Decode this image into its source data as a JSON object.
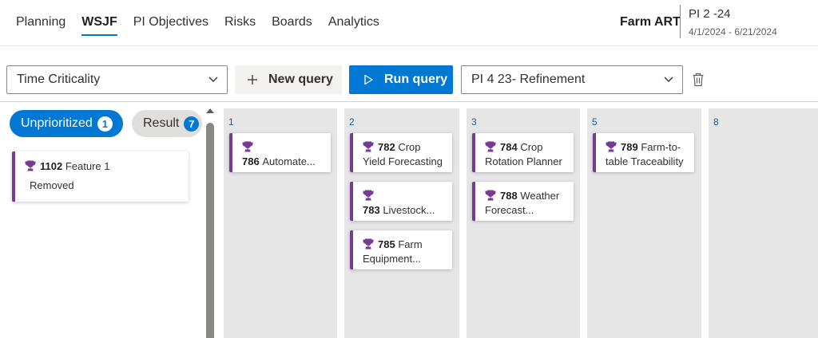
{
  "nav": {
    "tabs": [
      "Planning",
      "WSJF",
      "PI Objectives",
      "Risks",
      "Boards",
      "Analytics"
    ],
    "active_tab": "WSJF",
    "team": "Farm ART",
    "pi_name": "PI 2 -24",
    "pi_dates": "4/1/2024 - 6/21/2024"
  },
  "toolbar": {
    "criteria_select": "Time Criticality",
    "new_query_label": "New query",
    "run_query_label": "Run query",
    "query_select": "PI 4 23- Refinement"
  },
  "left_panel": {
    "unprioritized_label": "Unprioritized",
    "unprioritized_count": "1",
    "result_label": "Result",
    "result_count": "7",
    "cards": [
      {
        "id": "1102",
        "title": "Feature 1",
        "line2": "Removed"
      }
    ]
  },
  "columns": [
    {
      "number": "1",
      "cards": [
        {
          "id": "786",
          "line1": "",
          "line2": "Automate..."
        }
      ]
    },
    {
      "number": "2",
      "cards": [
        {
          "id": "782",
          "line1": "Crop",
          "line2": "Yield Forecasting"
        },
        {
          "id": "783",
          "line1": "",
          "line2": "Livestock..."
        },
        {
          "id": "785",
          "line1": "Farm",
          "line2": "Equipment..."
        }
      ]
    },
    {
      "number": "3",
      "cards": [
        {
          "id": "784",
          "line1": "Crop",
          "line2": "Rotation Planner"
        },
        {
          "id": "788",
          "line1": "Weather",
          "line2": "Forecast..."
        }
      ]
    },
    {
      "number": "5",
      "cards": [
        {
          "id": "789",
          "line1": "Farm-to-",
          "line2": "table Traceability"
        }
      ]
    },
    {
      "number": "8",
      "cards": []
    }
  ],
  "colors": {
    "accent": "#0078d4",
    "card_border": "#773b93",
    "column_bg": "#e6e6e6"
  },
  "icons": [
    "trophy-icon",
    "chevron-down-icon",
    "plus-icon",
    "play-icon",
    "trash-icon"
  ]
}
